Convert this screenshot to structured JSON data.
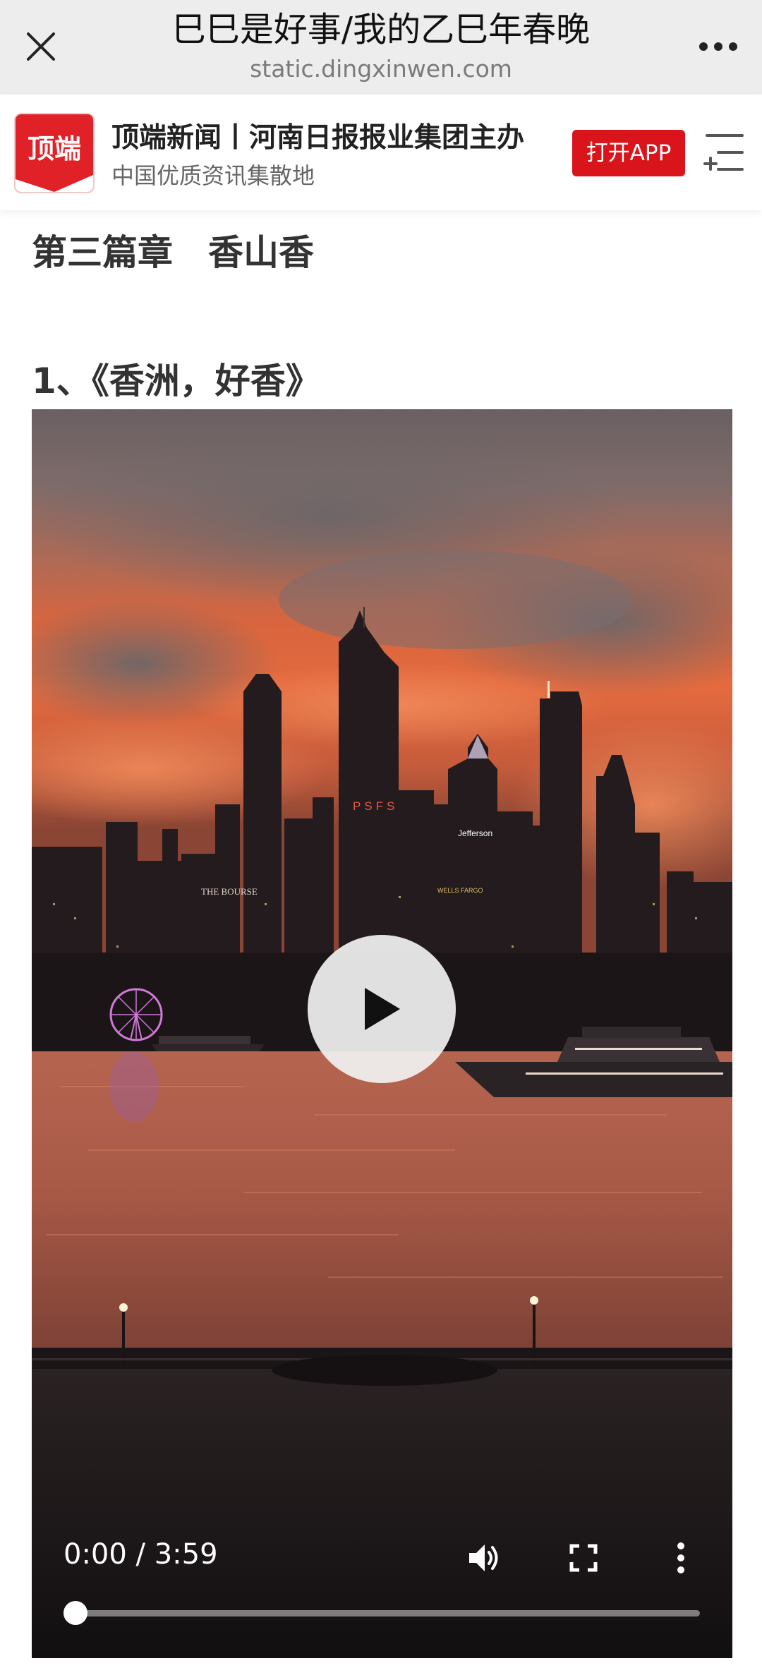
{
  "browser": {
    "title": "巳巳是好事/我的乙巳年春晚",
    "url": "static.dingxinwen.com"
  },
  "banner": {
    "logo_text": "顶端",
    "brand": "顶端新闻丨河南日报报业集团主办",
    "slogan": "中国优质资讯集散地",
    "open_app_label": "打开APP"
  },
  "article": {
    "chapter_heading": "第三篇章　香山香",
    "section_heading": "1、《香洲，好香》"
  },
  "video": {
    "current_time": "0:00",
    "duration": "3:59",
    "time_text": "0:00 / 3:59",
    "progress": 0,
    "scene_labels": {
      "psfs": "PSFS",
      "jefferson": "Jefferson",
      "bourse": "THE BOURSE",
      "wells_fargo": "WELLS FARGO"
    }
  },
  "colors": {
    "accent_red": "#d9141b",
    "topbar_bg": "#ededed"
  },
  "icons": {
    "close": "close-icon",
    "more": "more-dots-icon",
    "menu": "menu-add-icon",
    "play": "play-icon",
    "volume": "volume-icon",
    "fullscreen": "fullscreen-icon",
    "overflow": "vertical-dots-icon"
  }
}
